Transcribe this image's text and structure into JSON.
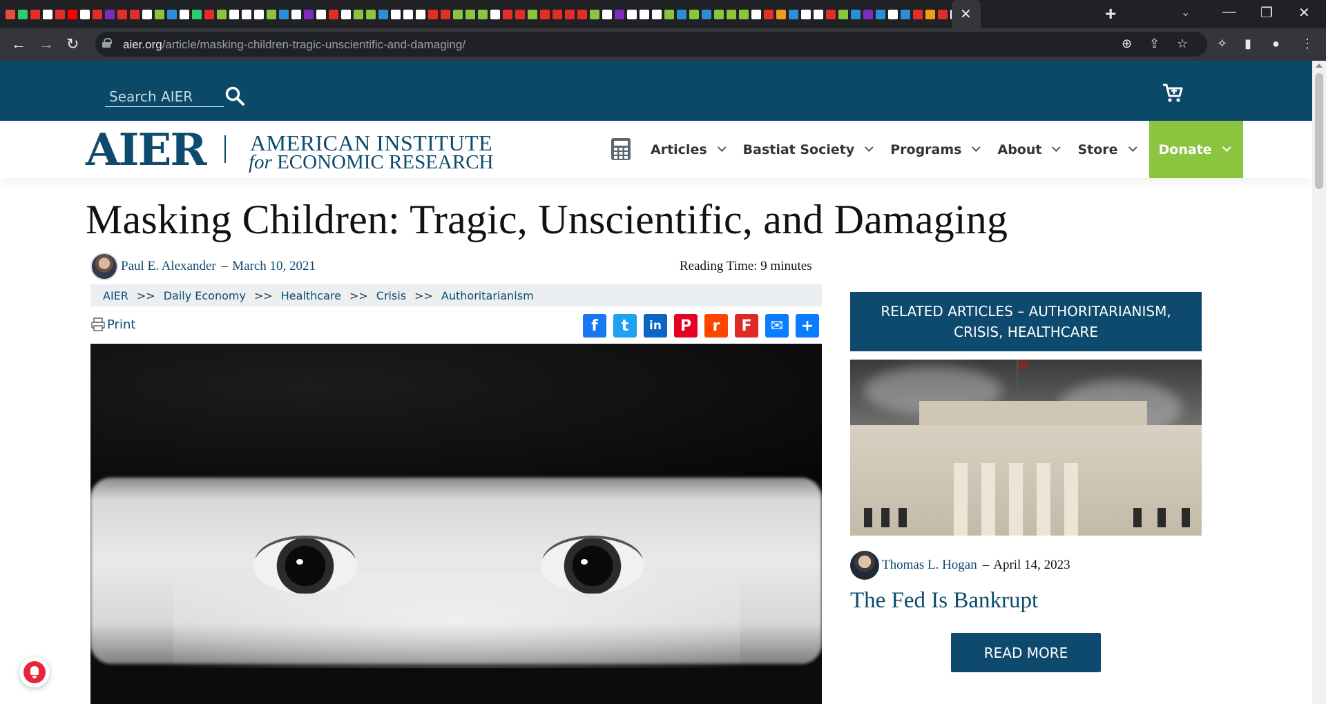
{
  "browser": {
    "url_domain": "aier.org",
    "url_path": "/article/masking-children-tragic-unscientific-and-damaging/",
    "tab_favicon_colors": [
      "#e74c3c",
      "#2ecc71",
      "#e52d27",
      "#ffffff",
      "#e52d27",
      "#ff0000",
      "#ffffff",
      "#e52d27",
      "#7b2cbf",
      "#e52d27",
      "#e52d27",
      "#ffffff",
      "#8bc540",
      "#2b8fd6",
      "#ffffff",
      "#2ecc71",
      "#e52d27",
      "#8bc540",
      "#ffffff",
      "#ffffff",
      "#ffffff",
      "#8bc540",
      "#2b8fd6",
      "#ffffff",
      "#7b2cbf",
      "#ffffff",
      "#e52d27",
      "#ffffff",
      "#8bc540",
      "#8bc540",
      "#2b8fd6",
      "#ffffff",
      "#ffffff",
      "#ffffff",
      "#e52d27",
      "#e52d27",
      "#8bc540",
      "#8bc540",
      "#8bc540",
      "#ffffff",
      "#e52d27",
      "#e52d27",
      "#8bc540",
      "#e52d27",
      "#e52d27",
      "#e52d27",
      "#e52d27",
      "#8bc540",
      "#ffffff",
      "#7b2cbf",
      "#ffffff",
      "#ffffff",
      "#ffffff",
      "#8bc540",
      "#2b8fd6",
      "#8bc540",
      "#2b8fd6",
      "#8bc540",
      "#8bc540",
      "#8bc540",
      "#ffffff",
      "#e52d27",
      "#f39c12",
      "#2b8fd6",
      "#ffffff",
      "#ffffff",
      "#e52d27",
      "#8bc540",
      "#2b8fd6",
      "#7b2cbf",
      "#2b8fd6",
      "#ffffff",
      "#2b8fd6",
      "#e52d27",
      "#f39c12",
      "#e52d27",
      "#ffffff"
    ],
    "icons": {
      "back": "arrow-left",
      "forward": "arrow-right",
      "reload": "reload",
      "zoom": "zoom",
      "share": "share",
      "bookmark": "star",
      "extensions": "puzzle",
      "sidebar": "sidebar",
      "profile": "person",
      "menu": "kebab"
    }
  },
  "header": {
    "search_placeholder": "Search AIER",
    "logo": {
      "wordmark": "AIER",
      "name_line1": "AMERICAN INSTITUTE",
      "name_line2_prefix": "for",
      "name_line2": "ECONOMIC RESEARCH"
    },
    "nav": [
      {
        "label": "Articles"
      },
      {
        "label": "Bastiat Society"
      },
      {
        "label": "Programs"
      },
      {
        "label": "About"
      },
      {
        "label": "Store"
      },
      {
        "label": "Donate"
      }
    ],
    "colors": {
      "primary": "#0d4a6e",
      "topbar": "#0a4a68",
      "donate": "#8bc540"
    }
  },
  "article": {
    "title": "Masking Children: Tragic, Unscientific, and Damaging",
    "author": "Paul E. Alexander",
    "separator": "–",
    "date": "March 10, 2021",
    "reading_time": "Reading Time: 9 minutes",
    "breadcrumbs": [
      "AIER",
      "Daily Economy",
      "Healthcare",
      "Crisis",
      "Authoritarianism"
    ],
    "breadcrumb_separator": ">>",
    "print_label": "Print",
    "share_buttons": [
      {
        "name": "facebook",
        "glyph": "f",
        "color": "#1877f2"
      },
      {
        "name": "twitter",
        "glyph": "t",
        "color": "#1da1f2"
      },
      {
        "name": "linkedin",
        "glyph": "in",
        "color": "#0a66c2"
      },
      {
        "name": "pinterest",
        "glyph": "P",
        "color": "#e60023"
      },
      {
        "name": "reddit",
        "glyph": "r",
        "color": "#ff4500"
      },
      {
        "name": "flipboard",
        "glyph": "F",
        "color": "#e12828"
      },
      {
        "name": "email",
        "glyph": "✉",
        "color": "#0a7cff"
      },
      {
        "name": "share",
        "glyph": "+",
        "color": "#0a7cff"
      }
    ]
  },
  "sidebar": {
    "header": "RELATED ARTICLES – AUTHORITARIANISM, CRISIS, HEALTHCARE",
    "related": {
      "author": "Thomas L. Hogan",
      "separator": "–",
      "date": "April 14, 2023",
      "title": "The Fed Is Bankrupt",
      "button": "READ MORE"
    }
  }
}
